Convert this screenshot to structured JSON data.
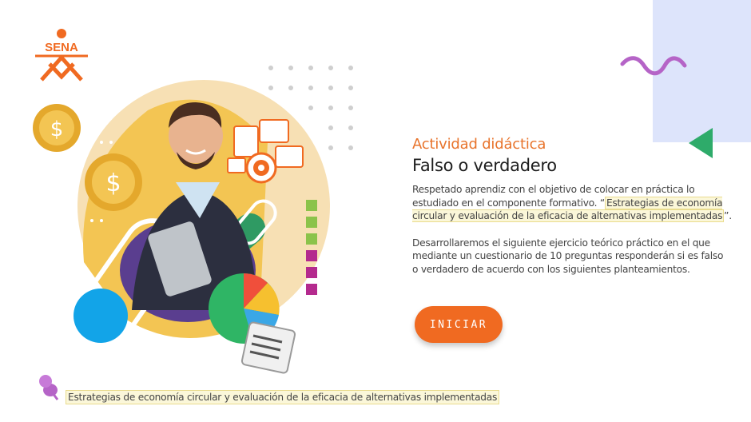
{
  "brand": {
    "logo_text": "SENA",
    "color": "#f06a21"
  },
  "activity": {
    "kicker": "Actividad didáctica",
    "title": "Falso o verdadero",
    "intro_before": "Respetado aprendiz con el objetivo de colocar en práctica lo estudiado en el componente formativo. “",
    "intro_highlight": "Estrategias de economía circular y evaluación de la eficacia de alternativas implementadas",
    "intro_after": "”.",
    "description": "Desarrollaremos el siguiente ejercicio teórico práctico en el que mediante un cuestionario de 10 preguntas responderán si es falso o verdadero de acuerdo con los siguientes planteamientos."
  },
  "start_button": {
    "label": "INICIAR"
  },
  "footer": {
    "topic": "Estrategias de economía circular y evaluación de la eficacia de alternativas implementadas"
  },
  "colors": {
    "accent": "#f06a21",
    "panel": "#dde4fb",
    "squiggle": "#b564c7",
    "triangle": "#2eab6a",
    "highlight": "#fbf7d9"
  }
}
